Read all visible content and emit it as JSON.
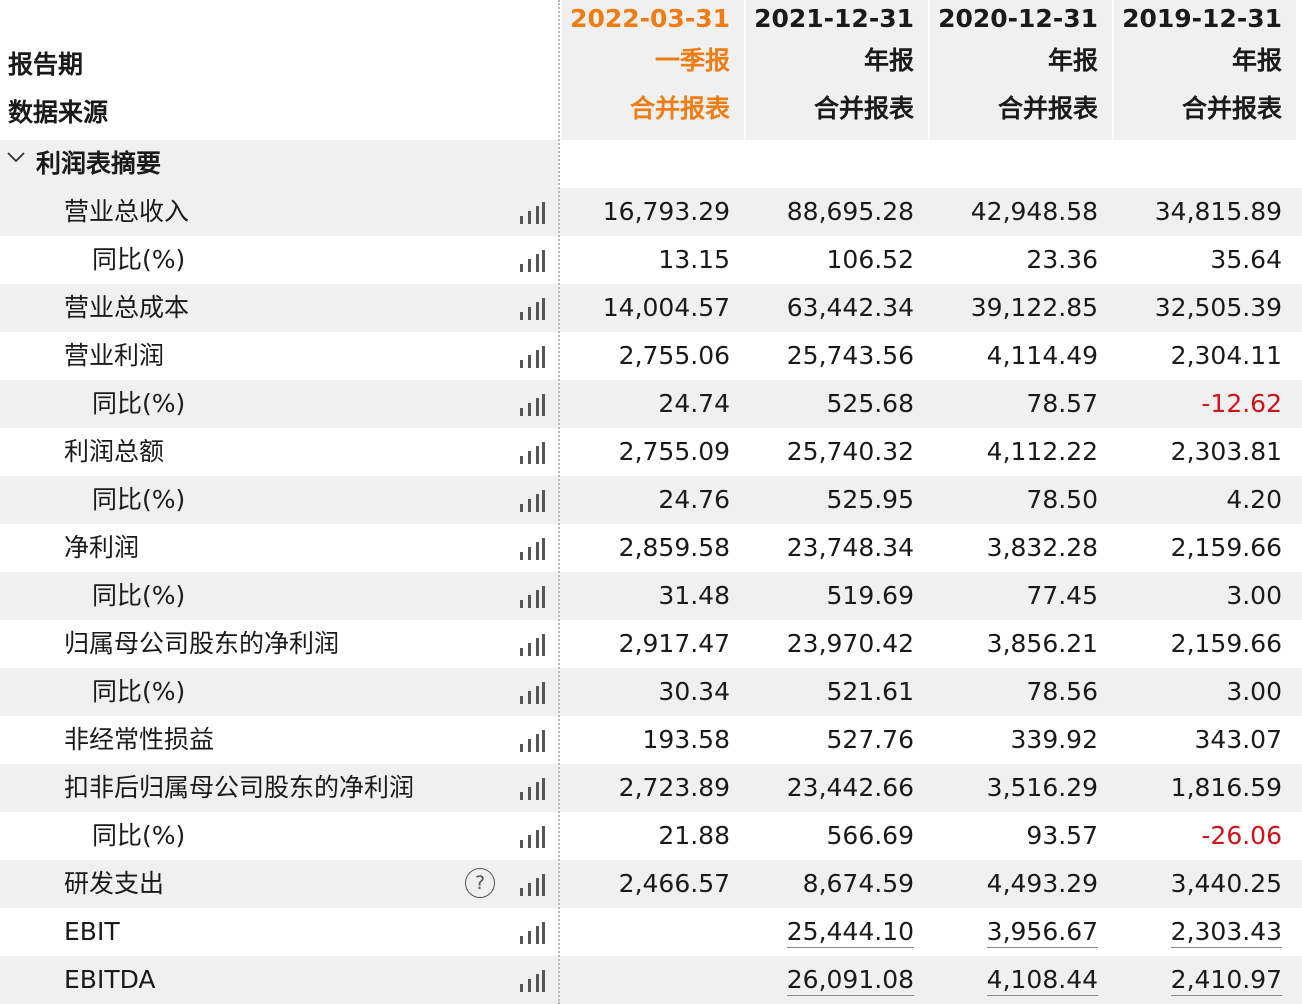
{
  "header": {
    "period_label": "报告期",
    "source_label": "数据来源",
    "columns": [
      {
        "date": "2022-03-31",
        "type": "一季报",
        "source": "合并报表"
      },
      {
        "date": "2021-12-31",
        "type": "年报",
        "source": "合并报表"
      },
      {
        "date": "2020-12-31",
        "type": "年报",
        "source": "合并报表"
      },
      {
        "date": "2019-12-31",
        "type": "年报",
        "source": "合并报表"
      }
    ]
  },
  "section": {
    "title": "利润表摘要",
    "icon": "chevron-down-icon"
  },
  "rows": [
    {
      "label": "营业总收入",
      "values": [
        "16,793.29",
        "88,695.28",
        "42,948.58",
        "34,815.89"
      ]
    },
    {
      "label": "同比(%)",
      "values": [
        "13.15",
        "106.52",
        "23.36",
        "35.64"
      ]
    },
    {
      "label": "营业总成本",
      "values": [
        "14,004.57",
        "63,442.34",
        "39,122.85",
        "32,505.39"
      ]
    },
    {
      "label": "营业利润",
      "values": [
        "2,755.06",
        "25,743.56",
        "4,114.49",
        "2,304.11"
      ]
    },
    {
      "label": "同比(%)",
      "values": [
        "24.74",
        "525.68",
        "78.57",
        "-12.62"
      ]
    },
    {
      "label": "利润总额",
      "values": [
        "2,755.09",
        "25,740.32",
        "4,112.22",
        "2,303.81"
      ]
    },
    {
      "label": "同比(%)",
      "values": [
        "24.76",
        "525.95",
        "78.50",
        "4.20"
      ]
    },
    {
      "label": "净利润",
      "values": [
        "2,859.58",
        "23,748.34",
        "3,832.28",
        "2,159.66"
      ]
    },
    {
      "label": "同比(%)",
      "values": [
        "31.48",
        "519.69",
        "77.45",
        "3.00"
      ]
    },
    {
      "label": "归属母公司股东的净利润",
      "values": [
        "2,917.47",
        "23,970.42",
        "3,856.21",
        "2,159.66"
      ]
    },
    {
      "label": "同比(%)",
      "values": [
        "30.34",
        "521.61",
        "78.56",
        "3.00"
      ]
    },
    {
      "label": "非经常性损益",
      "values": [
        "193.58",
        "527.76",
        "339.92",
        "343.07"
      ]
    },
    {
      "label": "扣非后归属母公司股东的净利润",
      "values": [
        "2,723.89",
        "23,442.66",
        "3,516.29",
        "1,816.59"
      ]
    },
    {
      "label": "同比(%)",
      "values": [
        "21.88",
        "566.69",
        "93.57",
        "-26.06"
      ]
    },
    {
      "label": "研发支出",
      "values": [
        "2,466.57",
        "8,674.59",
        "4,493.29",
        "3,440.25"
      ],
      "help": "?"
    },
    {
      "label": "EBIT",
      "values": [
        "",
        "25,444.10",
        "3,956.67",
        "2,303.43"
      ]
    },
    {
      "label": "EBITDA",
      "values": [
        "",
        "26,091.08",
        "4,108.44",
        "2,410.97"
      ]
    }
  ],
  "colors": {
    "accent": "#f07c14",
    "negative": "#d0131b",
    "shade": "#f0f0f0"
  }
}
